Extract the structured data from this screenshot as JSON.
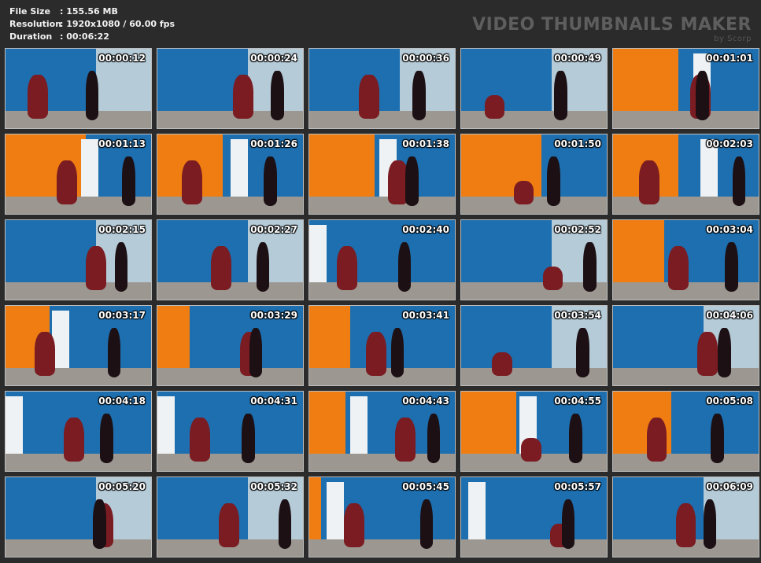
{
  "info": {
    "file_size_label": "File Size",
    "file_size_value": ": 155.56 MB",
    "resolution_label": "Resolution",
    "resolution_value": ": 1920x1080 / 60.00 fps",
    "duration_label": "Duration",
    "duration_value": ": 00:06:22"
  },
  "watermark": {
    "title": "VIDEO THUMBNAILS MAKER",
    "by": "by Scorp"
  },
  "thumbnails": [
    "00:00:12",
    "00:00:24",
    "00:00:36",
    "00:00:49",
    "00:01:01",
    "00:01:13",
    "00:01:26",
    "00:01:38",
    "00:01:50",
    "00:02:03",
    "00:02:15",
    "00:02:27",
    "00:02:40",
    "00:02:52",
    "00:03:04",
    "00:03:17",
    "00:03:29",
    "00:03:41",
    "00:03:54",
    "00:04:06",
    "00:04:18",
    "00:04:31",
    "00:04:43",
    "00:04:55",
    "00:05:08",
    "00:05:20",
    "00:05:32",
    "00:05:45",
    "00:05:57",
    "00:06:09"
  ]
}
